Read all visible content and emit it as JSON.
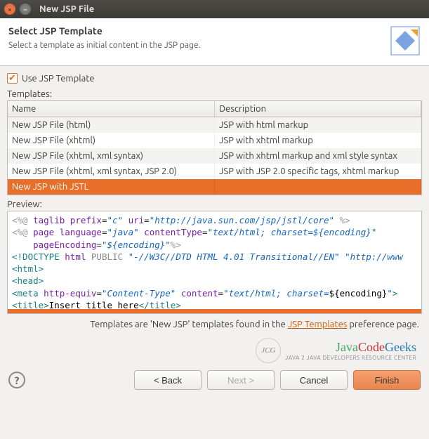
{
  "window": {
    "title": "New JSP File"
  },
  "header": {
    "title": "Select JSP Template",
    "subtitle": "Select a template as initial content in the JSP page."
  },
  "use_template_label": "Use JSP Template",
  "templates_label": "Templates:",
  "columns": {
    "name": "Name",
    "desc": "Description"
  },
  "rows": [
    {
      "name": "New JSP File (html)",
      "desc": "JSP with html markup"
    },
    {
      "name": "New JSP File (xhtml)",
      "desc": "JSP with xhtml markup"
    },
    {
      "name": "New JSP File (xhtml, xml syntax)",
      "desc": "JSP with xhtml markup and xml style syntax"
    },
    {
      "name": "New JSP File (xhtml, xml syntax, JSP 2.0)",
      "desc": "JSP with JSP 2.0 specific tags, xhtml markup"
    },
    {
      "name": "New JSP with JSTL",
      "desc": ""
    }
  ],
  "preview_label": "Preview:",
  "footer_note_pre": "Templates are 'New JSP' templates found in the ",
  "footer_note_link": "JSP Templates",
  "footer_note_post": " preference page.",
  "logo": {
    "text1": "Java",
    "text2": "Code",
    "text3": "Geeks",
    "sub": "JAVA 2 JAVA DEVELOPERS RESOURCE CENTER",
    "badge": "JCG"
  },
  "buttons": {
    "back": "< Back",
    "next": "Next >",
    "cancel": "Cancel",
    "finish": "Finish"
  },
  "help_glyph": "?",
  "check_glyph": "✔",
  "preview_code": {
    "l1": {
      "a": "<%@",
      "b": " taglib",
      "c": " prefix",
      "d": "=",
      "e": "\"c\"",
      "f": " uri",
      "g": "=",
      "h": "\"http://java.sun.com/jsp/jstl/core\"",
      "i": " %>"
    },
    "l2": {
      "a": "<%@",
      "b": " page",
      "c": " language",
      "d": "=",
      "e": "\"java\"",
      "f": " contentType",
      "g": "=",
      "h": "\"text/html; charset=${encoding}\""
    },
    "l3": {
      "a": "    pageEncoding",
      "b": "=",
      "c": "\"${encoding}\"",
      "d": "%>"
    },
    "l4": {
      "a": "<!DOCTYPE ",
      "b": "html ",
      "c": "PUBLIC ",
      "d": "\"-//W3C//DTD HTML 4.01 Transitional//EN\"",
      "e": " \"http://www"
    },
    "l5": "<html>",
    "l6": "<head>",
    "l7": {
      "a": "<meta",
      "b": " http-equiv",
      "c": "=",
      "d": "\"Content-Type\"",
      "e": " content",
      "f": "=",
      "g": "\"text/html; charset=",
      "h": "${encoding}",
      "i": "\"",
      "j": ">"
    },
    "l8": {
      "a": "<title>",
      "b": "Insert title here",
      "c": "</title>"
    }
  }
}
